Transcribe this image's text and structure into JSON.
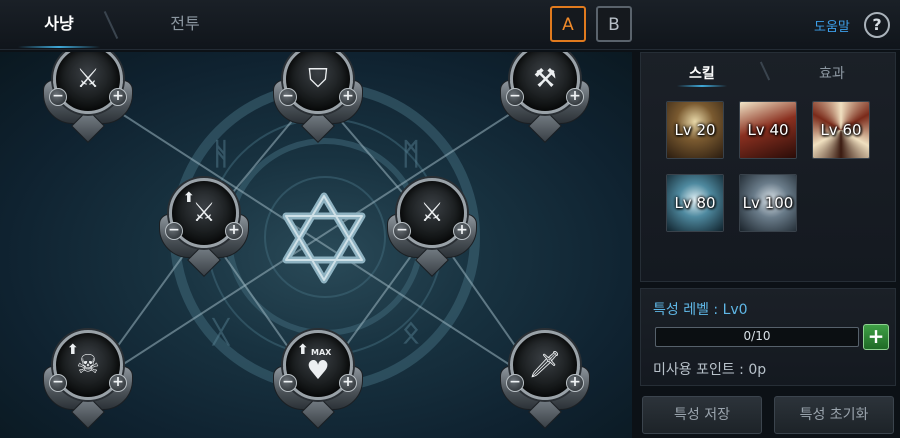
{
  "top_tabs": {
    "active": "사냥",
    "inactive": "전투"
  },
  "presets": {
    "a": "A",
    "b": "B",
    "selected": "A"
  },
  "help": {
    "label": "도움말",
    "icon": "?"
  },
  "colors": {
    "accent_orange": "#e07a1e",
    "help_blue": "#3c9ee8",
    "level_cyan": "#5fb7e6",
    "plus_green": "#3fa046"
  },
  "board": {
    "center_icon": "hexagram-icon",
    "nodes": [
      {
        "id": "top-left",
        "icon": "sword-icon",
        "minus": "−",
        "plus": "+"
      },
      {
        "id": "top-center",
        "icon": "shield-icon",
        "minus": "−",
        "plus": "+"
      },
      {
        "id": "top-right",
        "icon": "axe-icon",
        "minus": "−",
        "plus": "+"
      },
      {
        "id": "mid-left",
        "icon": "crossed-weapon-up-icon",
        "minus": "−",
        "plus": "+"
      },
      {
        "id": "mid-right",
        "icon": "crossed-weapon-icon",
        "minus": "−",
        "plus": "+"
      },
      {
        "id": "bottom-left",
        "icon": "demon-skull-up-icon",
        "minus": "−",
        "plus": "+"
      },
      {
        "id": "bottom-center",
        "icon": "heart-max-icon",
        "tag": "MAX",
        "minus": "−",
        "plus": "+"
      },
      {
        "id": "bottom-right",
        "icon": "weapon-strike-icon",
        "minus": "−",
        "plus": "+"
      }
    ]
  },
  "panel": {
    "tabs": {
      "active": "스킬",
      "inactive": "효과"
    },
    "skills": [
      {
        "label": "Lv 20"
      },
      {
        "label": "Lv 40"
      },
      {
        "label": "Lv 60"
      },
      {
        "label": "Lv 80"
      },
      {
        "label": "Lv 100"
      }
    ]
  },
  "stats": {
    "level_label": "특성 레벨 : Lv0",
    "progress_text": "0/10",
    "progress_fraction": 0.0,
    "unused_points": "미사용 포인트 : 0p",
    "plus_label": "+"
  },
  "actions": {
    "save": "특성 저장",
    "reset": "특성 초기화"
  }
}
